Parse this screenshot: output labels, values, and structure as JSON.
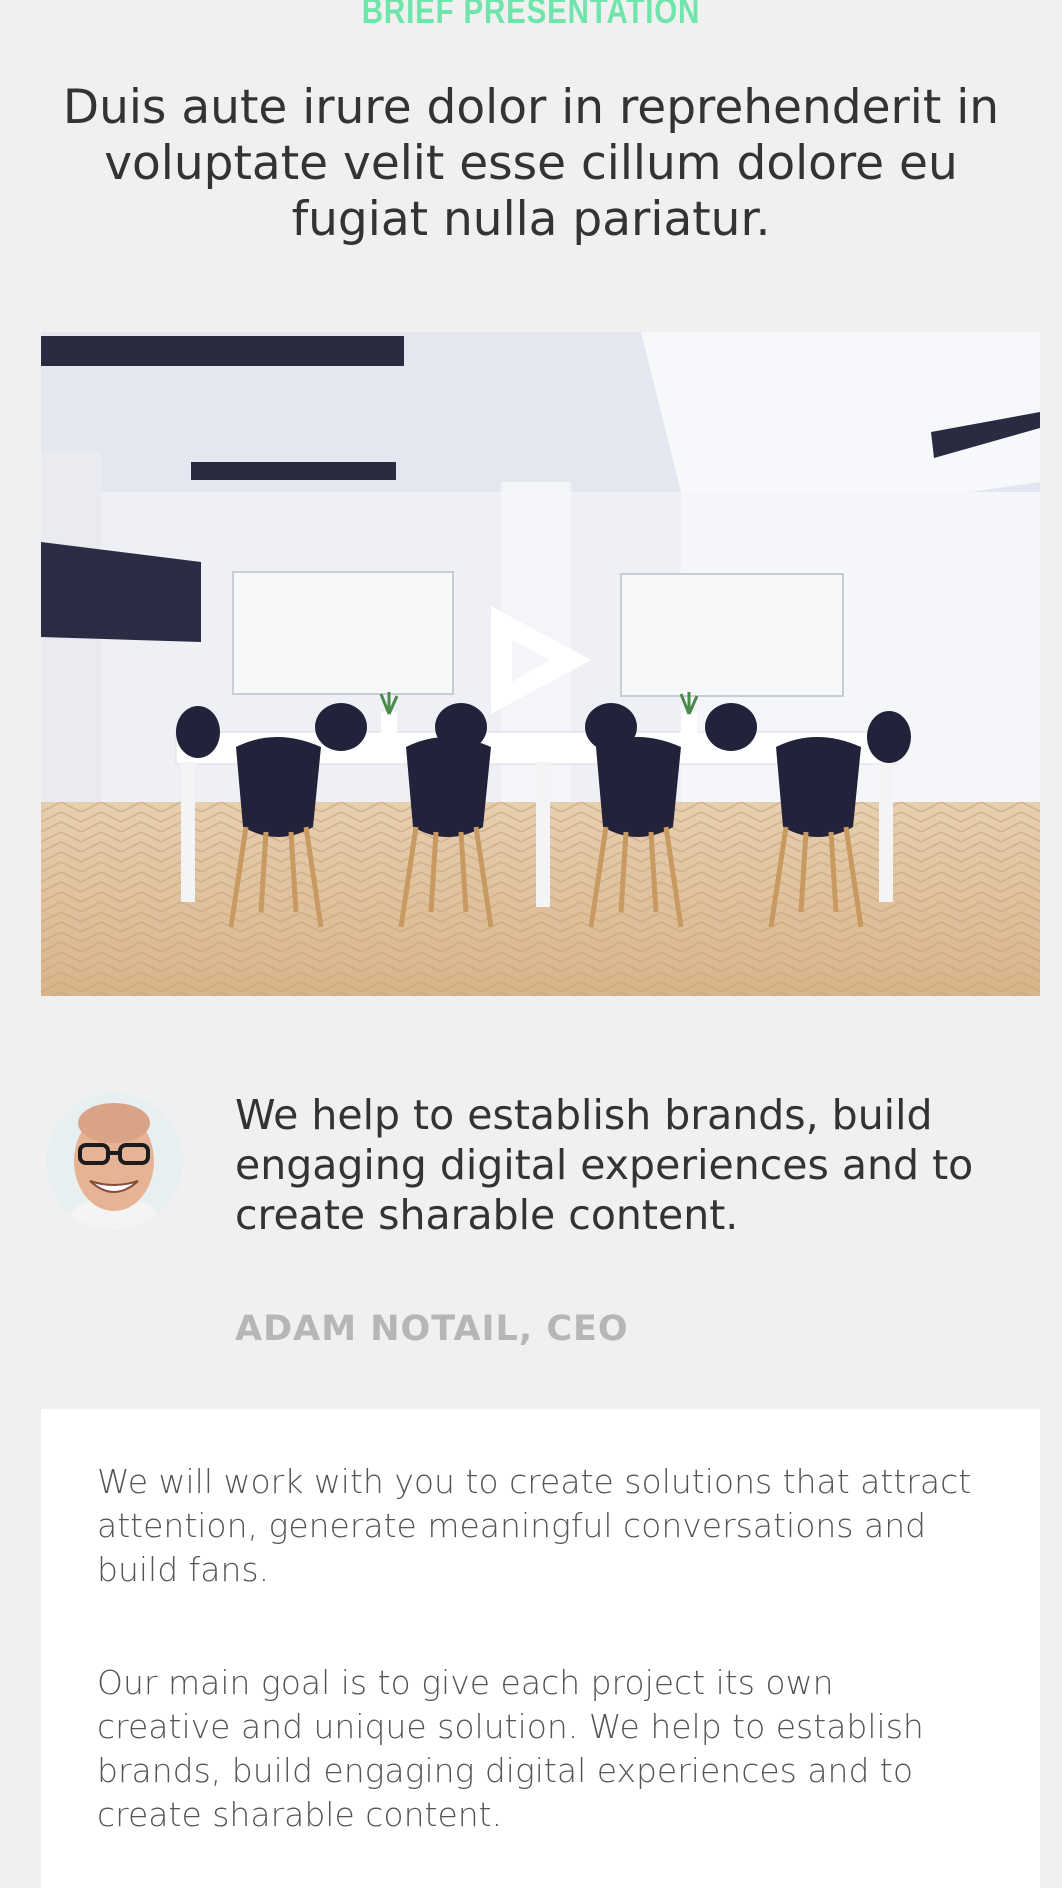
{
  "section": {
    "eyebrow": "BRIEF PRESENTATION",
    "headline": "Duis aute irure dolor in reprehenderit in voluptate velit esse cillum dolore eu fugiat nulla pariatur."
  },
  "video": {
    "play_icon": "play-icon"
  },
  "testimonial": {
    "quote": "We help to establish brands, build engaging digital experiences and to create sharable content.",
    "author": "ADAM NOTAIL, CEO",
    "avatar_icon": "avatar"
  },
  "about": {
    "paragraph_1": "We will work with you to create solutions that attract attention, generate meaningful conversations and build fans.",
    "paragraph_2": "Our main goal is to give each project its own creative and unique solution. We help to establish brands, build engaging digital experiences and to create sharable content."
  },
  "colors": {
    "accent": "#6fe5ac",
    "background": "#f0f0f0",
    "muted": "#b6b6b6"
  }
}
